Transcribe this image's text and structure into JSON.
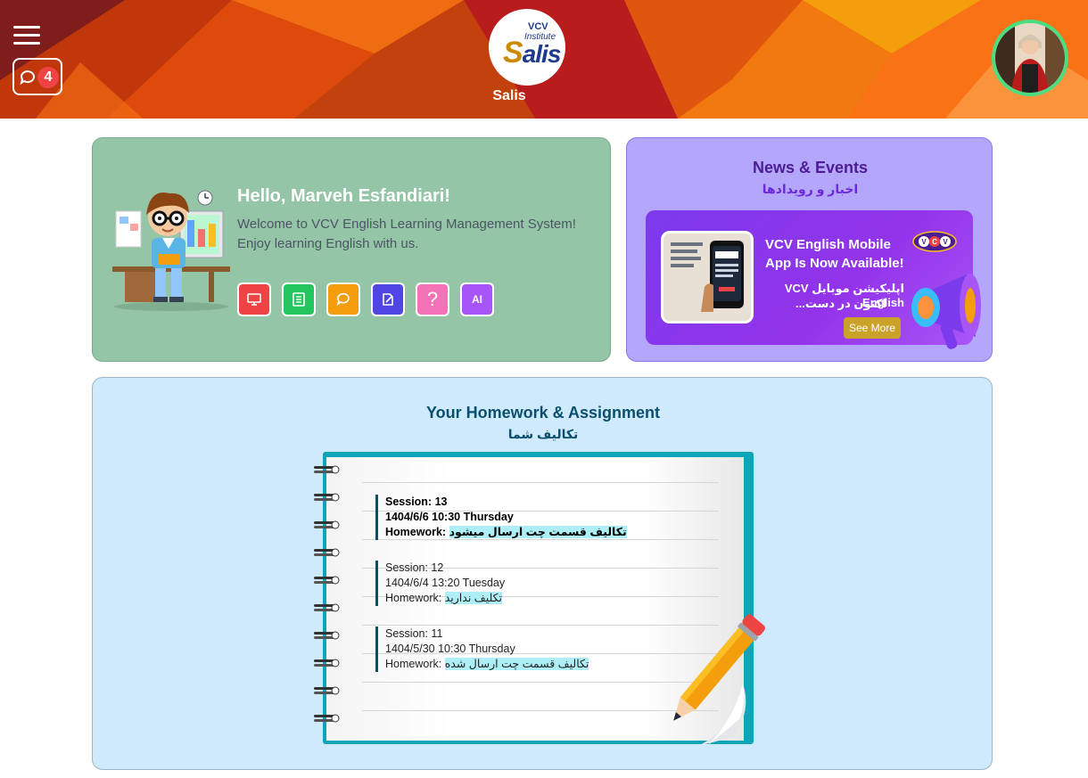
{
  "header": {
    "app_name": "Salis",
    "logo": {
      "top_text": "VCV",
      "middle_text": "Institute",
      "main_text": "alis",
      "initial": "S"
    },
    "chat_badge_count": "4",
    "colors": {
      "header_primary": "#ea580c",
      "header_dark": "#b91c1c",
      "avatar_ring": "#4ade80"
    }
  },
  "greeting": {
    "title": "Hello, Marveh Esfandiari!",
    "line1": "Welcome to VCV English Learning Management System!",
    "line2": "Enjoy learning English with us.",
    "quick_actions": [
      {
        "icon": "monitor-icon",
        "color": "#ef4444"
      },
      {
        "icon": "book-icon",
        "color": "#22c55e"
      },
      {
        "icon": "chat-icon",
        "color": "#f59e0b"
      },
      {
        "icon": "edit-icon",
        "color": "#4f46e5"
      },
      {
        "icon": "question-icon",
        "label": "?",
        "color": "#f472b6"
      },
      {
        "icon": "ai-icon",
        "label": "AI",
        "color": "#a855f7"
      }
    ]
  },
  "news": {
    "title": "News & Events",
    "subtitle": "اخبار و رویدادها",
    "banner": {
      "heading_line1": "VCV English Mobile",
      "heading_line2": "App Is Now Available!",
      "fa_line1": "اپلیکیشن موبایل VCV English",
      "fa_line2": "اکنون در دست...",
      "see_more": "See More",
      "badge": "VCV"
    }
  },
  "homework": {
    "title": "Your Homework & Assignment",
    "subtitle": "تکالیف شما",
    "homework_label": "Homework:",
    "entries": [
      {
        "session": "Session: 13",
        "datetime": "1404/6/6  10:30  Thursday",
        "homework": "تکالیف قسمت چت ارسال میشود"
      },
      {
        "session": "Session: 12",
        "datetime": "1404/6/4  13:20  Tuesday",
        "homework": "تکلیف ندارید"
      },
      {
        "session": "Session: 11",
        "datetime": "1404/5/30  10:30  Thursday",
        "homework": "تکالیف قسمت چت ارسال شده"
      }
    ]
  }
}
